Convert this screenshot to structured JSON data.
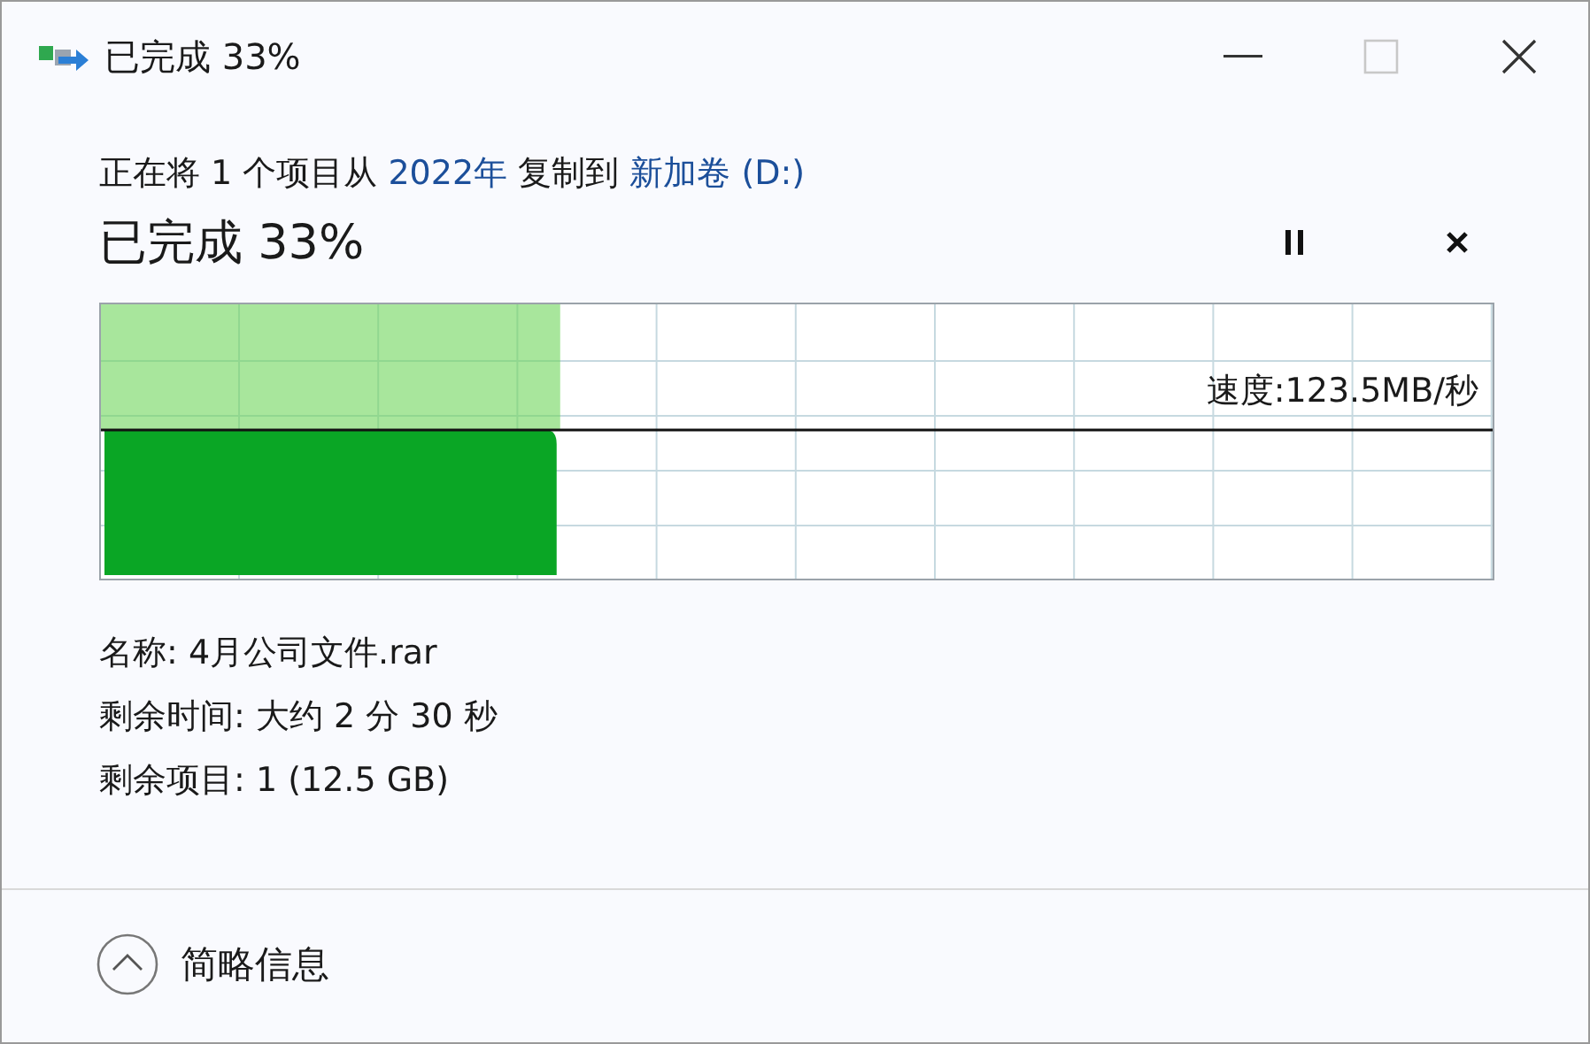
{
  "window": {
    "title": "已完成 33%"
  },
  "copy_line": [
    {
      "text": "正在将 1 个项目从 ",
      "kind": "plain"
    },
    {
      "text": "2022年",
      "kind": "link"
    },
    {
      "text": " 复制到 ",
      "kind": "plain"
    },
    {
      "text": "新加卷 (D:)",
      "kind": "link"
    }
  ],
  "progress": {
    "heading": "已完成 33%",
    "level": 0.33,
    "speed": "速度:123.5MB/秒"
  },
  "details": [
    "名称: 4月公司文件.rar",
    "剩余时间: 大约 2 分 30 秒",
    "剩余项目: 1 (12.5 GB)"
  ],
  "footer": {
    "toggle": "简略信息"
  }
}
